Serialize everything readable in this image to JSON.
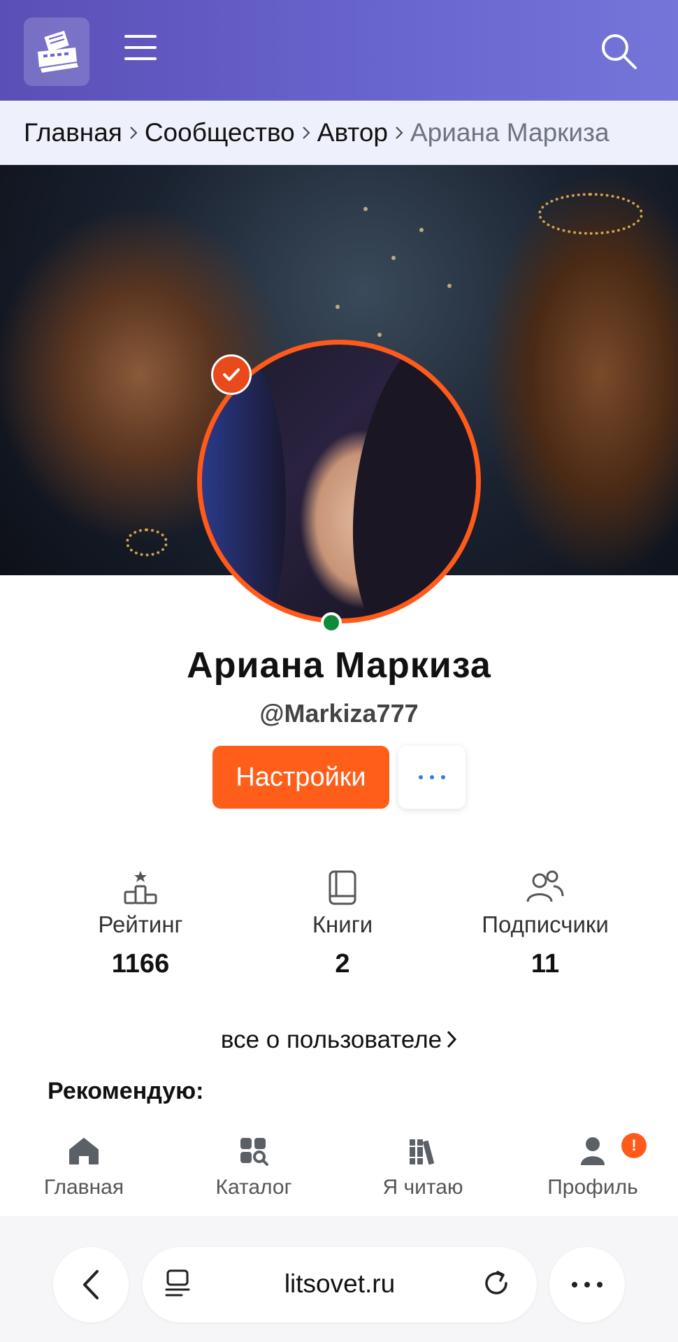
{
  "header": {
    "logo_icon": "typewriter-icon",
    "menu_icon": "hamburger-icon",
    "search_icon": "search-icon"
  },
  "breadcrumb": {
    "items": [
      "Главная",
      "Сообщество",
      "Автор",
      "Ариана Маркиза"
    ]
  },
  "profile": {
    "name": "Ариана Маркиза",
    "handle": "@Markiza777",
    "settings_label": "Настройки",
    "verified": true,
    "online": true
  },
  "stats": [
    {
      "label": "Рейтинг",
      "value": "1166",
      "icon": "rating-podium-icon"
    },
    {
      "label": "Книги",
      "value": "2",
      "icon": "book-icon"
    },
    {
      "label": "Подписчики",
      "value": "11",
      "icon": "users-icon"
    }
  ],
  "about_link": "все о пользователе",
  "recommend_title": "Рекомендую:",
  "bottom_nav": {
    "items": [
      {
        "label": "Главная",
        "icon": "home-icon"
      },
      {
        "label": "Каталог",
        "icon": "catalog-icon"
      },
      {
        "label": "Я читаю",
        "icon": "books-icon"
      },
      {
        "label": "Профиль",
        "icon": "profile-icon"
      }
    ],
    "profile_badge": "!"
  },
  "browser": {
    "url": "litsovet.ru"
  },
  "colors": {
    "header_start": "#5a4fb5",
    "header_end": "#7575d8",
    "accent_orange": "#ff5e1a",
    "online_green": "#0f8a3a",
    "breadcrumb_bg": "#eef0fb"
  }
}
